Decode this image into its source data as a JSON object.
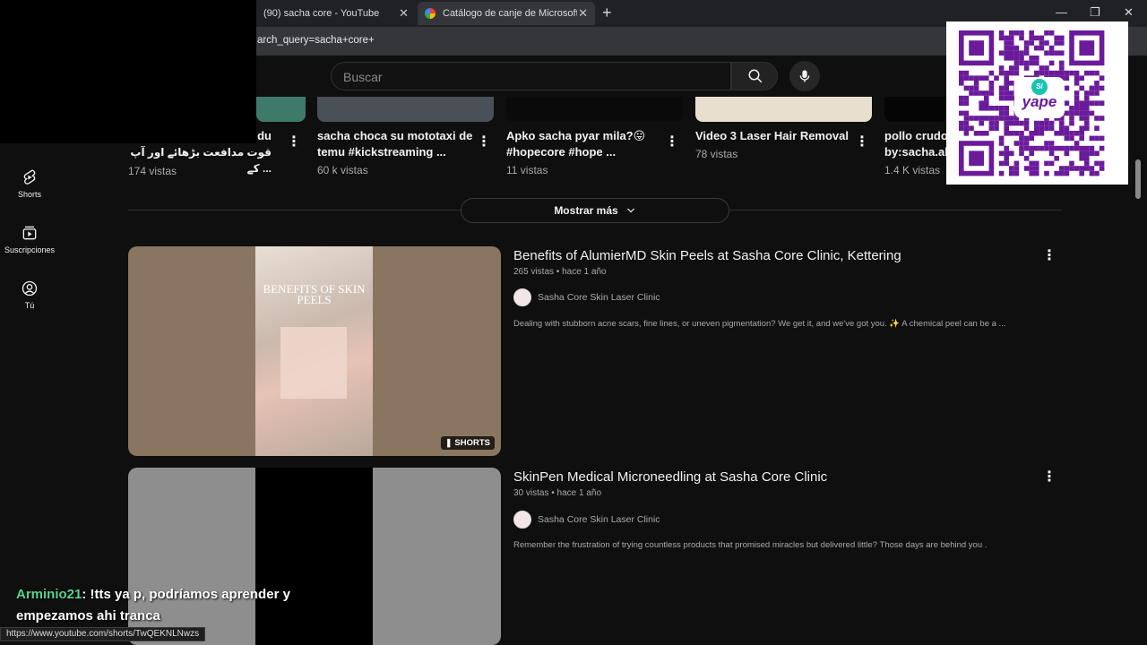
{
  "browser": {
    "tabs": [
      {
        "label": "(90) sacha core - YouTube"
      },
      {
        "label": "Catálogo de canje de Microsoft R"
      }
    ],
    "address": "arch_query=sacha+core+"
  },
  "search": {
    "placeholder": "Buscar"
  },
  "sidebar": {
    "items": [
      {
        "label": "Shorts",
        "icon": "shorts-icon"
      },
      {
        "label": "Suscripciones",
        "icon": "subscriptions-icon"
      },
      {
        "label": "Tú",
        "icon": "you-icon"
      }
    ]
  },
  "top_results": [
    {
      "title_line1": "du",
      "title_line2": "قوت مدافعت بڑھائے اور آپ کے ...",
      "views": "174 vistas"
    },
    {
      "title_line1": "sacha choca su mototaxi de",
      "title_line2": "temu #kickstreaming ...",
      "views": "60 k vistas"
    },
    {
      "title_line1": "Apko sacha pyar mila?😛",
      "title_line2": "#hopecore #hope ...",
      "views": "11 vistas"
    },
    {
      "title_line1": "Video 3 Laser Hair Removal",
      "title_line2": "",
      "views": "78 vistas"
    },
    {
      "title_line1": "pollo crudo",
      "title_line2": "by:sacha.aly",
      "views": "1.4 K vistas"
    }
  ],
  "show_more": "Mostrar más",
  "videos": [
    {
      "title": "Benefits of AlumierMD Skin Peels at Sasha Core Clinic, Kettering",
      "meta": "265 vistas • hace 1 año",
      "channel": "Sasha Core Skin Laser Clinic",
      "description": "Dealing with stubborn acne scars, fine lines, or uneven pigmentation? We get it, and we've got you. ✨ A chemical peel can be a ...",
      "thumb_text": "BENEFITS OF SKIN PEELS",
      "badge": "SHORTS"
    },
    {
      "title": "SkinPen Medical Microneedling at Sasha Core Clinic",
      "meta": "30 vistas • hace 1 año",
      "channel": "Sasha Core Skin Laser Clinic",
      "description": "Remember the frustration of trying countless products that promised miracles but delivered little? Those days are behind you ."
    }
  ],
  "qr": {
    "brand": "yape"
  },
  "chat": {
    "user": "Arminio21",
    "message": ": !tts ya p, podríamos aprender y empezamos ahi tranca"
  },
  "status_url": "https://www.youtube.com/shorts/TwQEKNLNwzs",
  "colors": {
    "accent_green": "#57d38c",
    "qr_purple": "#6a1b9a",
    "background": "#0f0f0f"
  }
}
